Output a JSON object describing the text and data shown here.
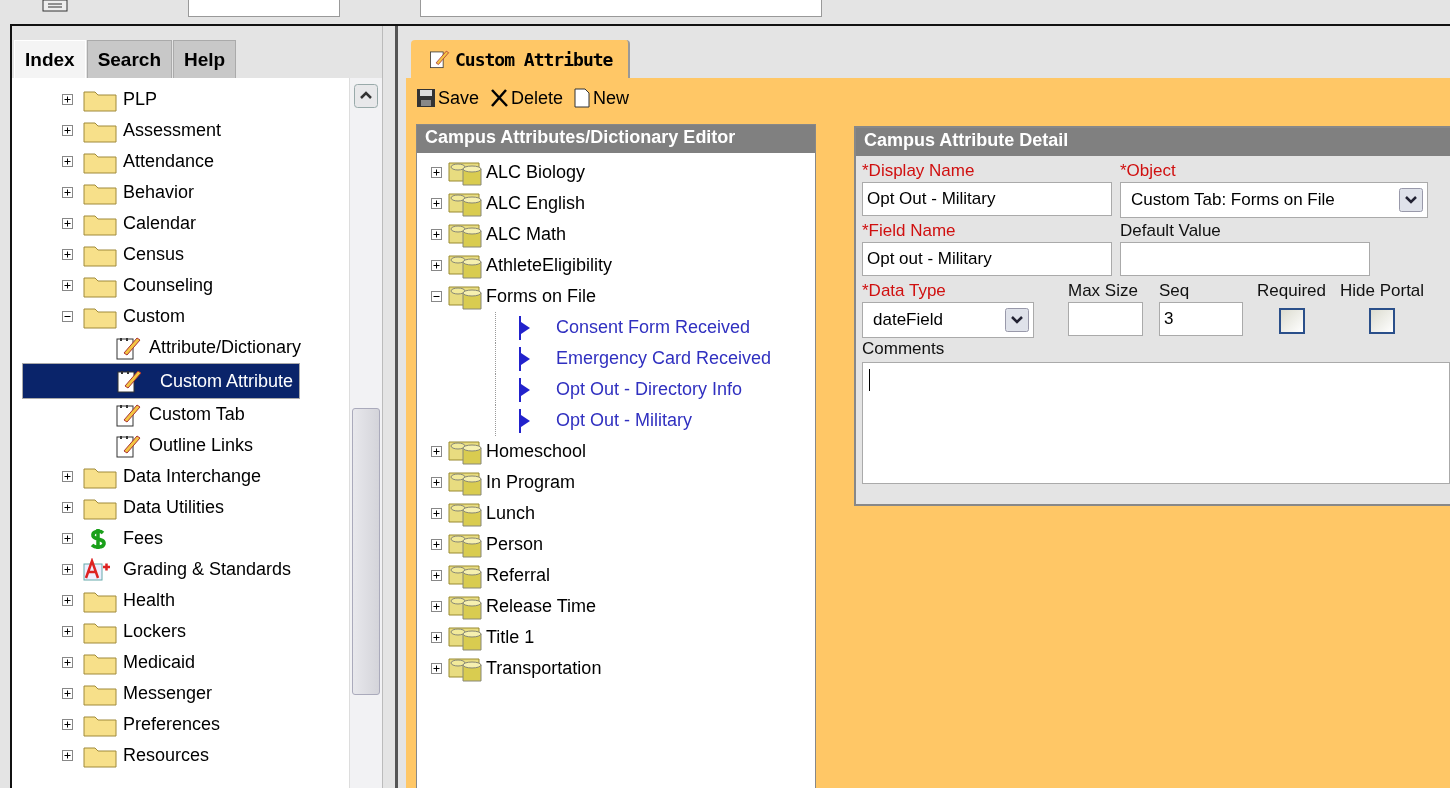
{
  "nav_tabs": [
    {
      "label": "Index",
      "selected": true
    },
    {
      "label": "Search",
      "selected": false
    },
    {
      "label": "Help",
      "selected": false
    }
  ],
  "nav_tree": [
    {
      "label": "PLP",
      "kind": "folder",
      "expanded": false,
      "selected": false
    },
    {
      "label": "Assessment",
      "kind": "folder",
      "expanded": false,
      "selected": false
    },
    {
      "label": "Attendance",
      "kind": "folder",
      "expanded": false,
      "selected": false
    },
    {
      "label": "Behavior",
      "kind": "folder",
      "expanded": false,
      "selected": false
    },
    {
      "label": "Calendar",
      "kind": "folder",
      "expanded": false,
      "selected": false
    },
    {
      "label": "Census",
      "kind": "folder",
      "expanded": false,
      "selected": false
    },
    {
      "label": "Counseling",
      "kind": "folder",
      "expanded": false,
      "selected": false
    },
    {
      "label": "Custom",
      "kind": "folder",
      "expanded": true,
      "selected": false,
      "children": [
        {
          "label": "Attribute/Dictionary",
          "kind": "page",
          "selected": false
        },
        {
          "label": "Custom Attribute",
          "kind": "page",
          "selected": true
        },
        {
          "label": "Custom Tab",
          "kind": "page",
          "selected": false
        },
        {
          "label": "Outline Links",
          "kind": "page",
          "selected": false
        }
      ]
    },
    {
      "label": "Data Interchange",
      "kind": "folder",
      "expanded": false,
      "selected": false
    },
    {
      "label": "Data Utilities",
      "kind": "folder",
      "expanded": false,
      "selected": false
    },
    {
      "label": "Fees",
      "kind": "money",
      "expanded": false,
      "selected": false
    },
    {
      "label": "Grading & Standards",
      "kind": "grade",
      "expanded": false,
      "selected": false
    },
    {
      "label": "Health",
      "kind": "folder",
      "expanded": false,
      "selected": false
    },
    {
      "label": "Lockers",
      "kind": "folder",
      "expanded": false,
      "selected": false
    },
    {
      "label": "Medicaid",
      "kind": "folder",
      "expanded": false,
      "selected": false
    },
    {
      "label": "Messenger",
      "kind": "folder",
      "expanded": false,
      "selected": false
    },
    {
      "label": "Preferences",
      "kind": "folder",
      "expanded": false,
      "selected": false
    },
    {
      "label": "Resources",
      "kind": "folder",
      "expanded": false,
      "selected": false
    }
  ],
  "content_tab": {
    "label": "Custom Attribute"
  },
  "actions": [
    {
      "label": "Save",
      "kind": "save"
    },
    {
      "label": "Delete",
      "kind": "delete"
    },
    {
      "label": "New",
      "kind": "new"
    }
  ],
  "editor": {
    "title": "Campus Attributes/Dictionary Editor",
    "items": [
      {
        "label": "ALC Biology",
        "expanded": false
      },
      {
        "label": "ALC English",
        "expanded": false
      },
      {
        "label": "ALC Math",
        "expanded": false
      },
      {
        "label": "AthleteEligibility",
        "expanded": false
      },
      {
        "label": "Forms on File",
        "expanded": true,
        "children": [
          {
            "label": "Consent Form Received"
          },
          {
            "label": "Emergency Card Received"
          },
          {
            "label": "Opt Out - Directory Info"
          },
          {
            "label": "Opt Out - Military"
          }
        ]
      },
      {
        "label": "Homeschool",
        "expanded": false
      },
      {
        "label": "In Program",
        "expanded": false
      },
      {
        "label": "Lunch",
        "expanded": false
      },
      {
        "label": "Person",
        "expanded": false
      },
      {
        "label": "Referral",
        "expanded": false
      },
      {
        "label": "Release Time",
        "expanded": false
      },
      {
        "label": "Title 1",
        "expanded": false
      },
      {
        "label": "Transportation",
        "expanded": false
      }
    ]
  },
  "detail": {
    "title": "Campus Attribute Detail",
    "display_name": {
      "label": "*Display Name",
      "value": "Opt Out - Military",
      "required": true
    },
    "object": {
      "label": "*Object",
      "value": "Custom Tab: Forms on File",
      "required": true
    },
    "field_name": {
      "label": "*Field Name",
      "value": "Opt out - Military",
      "required": true
    },
    "default_value": {
      "label": "Default Value",
      "required": false
    },
    "data_type": {
      "label": "*Data Type",
      "value": "dateField",
      "required": true
    },
    "max_size": {
      "label": "Max Size"
    },
    "seq": {
      "label": "Seq",
      "value": "3"
    },
    "required_box": {
      "label": "Required",
      "checked": false
    },
    "hide_portal": {
      "label": "Hide Portal",
      "checked": false
    },
    "comments": {
      "label": "Comments"
    }
  }
}
